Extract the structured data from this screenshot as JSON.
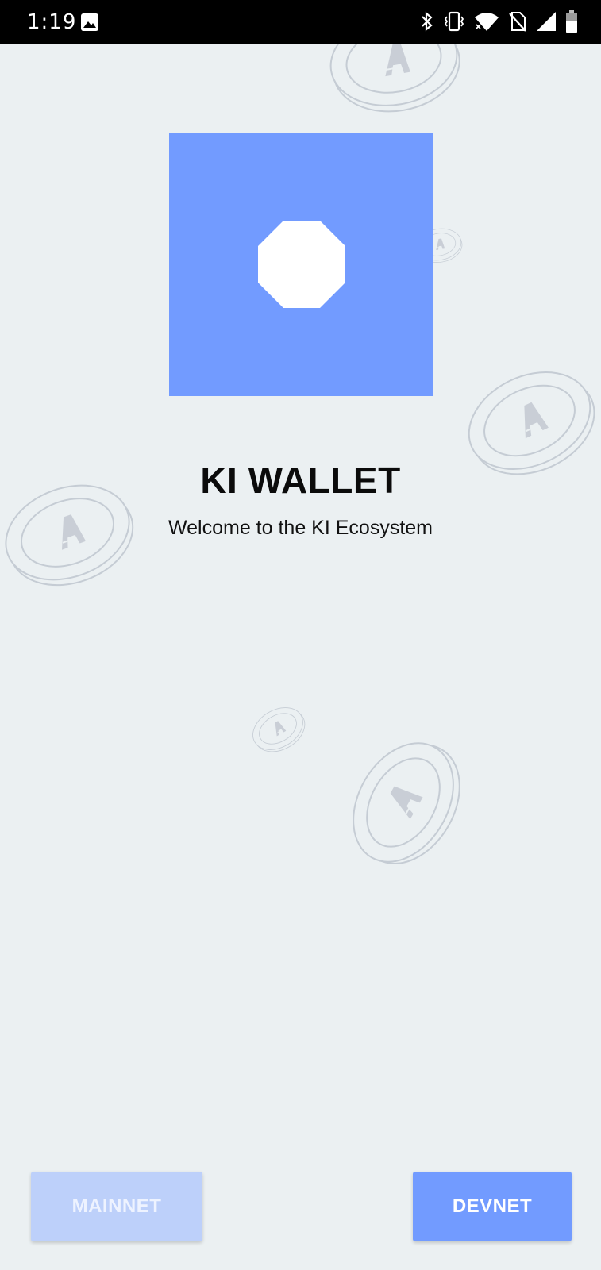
{
  "status_bar": {
    "time": "1:19",
    "icons": [
      "image-icon",
      "bluetooth-icon",
      "vibrate-icon",
      "wifi-icon",
      "no-sim-icon",
      "signal-icon",
      "battery-icon"
    ]
  },
  "app": {
    "title": "KI WALLET",
    "subtitle": "Welcome to the KI Ecosystem",
    "logo": "octagon-logo-icon",
    "colors": {
      "accent": "#729bff",
      "accent_disabled": "#bdd0fa",
      "background": "#ebf0f2"
    }
  },
  "buttons": {
    "mainnet_label": "MAINNET",
    "devnet_label": "DEVNET"
  }
}
